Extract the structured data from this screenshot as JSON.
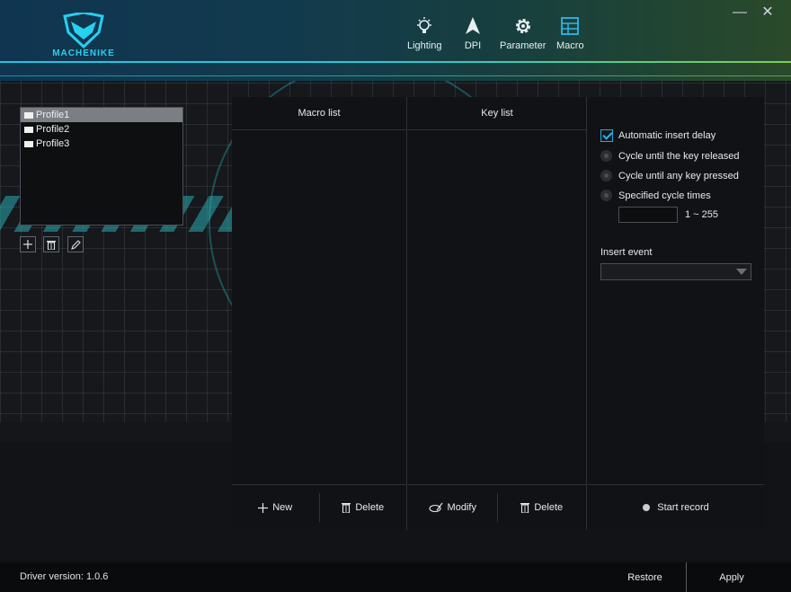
{
  "brand": {
    "logo_text": "MACHENIKE"
  },
  "nav": [
    {
      "label": "Lighting",
      "icon": "bulb-icon"
    },
    {
      "label": "DPI",
      "icon": "arrow-cursor-icon"
    },
    {
      "label": "Parameter",
      "icon": "gear-icon"
    },
    {
      "label": "Macro",
      "icon": "grid-icon",
      "active": true
    }
  ],
  "window": {
    "minimize": "—",
    "close": "✕"
  },
  "profiles": {
    "items": [
      "Profile1",
      "Profile2",
      "Profile3"
    ],
    "selected": "Profile1",
    "tools": [
      "add-icon",
      "trash-icon",
      "pencil-icon"
    ]
  },
  "macro_list": {
    "header": "Macro list",
    "new_label": "New",
    "delete_label": "Delete"
  },
  "key_list": {
    "header": "Key list",
    "modify_label": "Modify",
    "delete_label": "Delete"
  },
  "options": {
    "auto_delay_label": "Automatic insert delay",
    "auto_delay_checked": true,
    "radio_options": [
      "Cycle until the key released",
      "Cycle until any key pressed",
      "Specified cycle times"
    ],
    "cycle_value": "",
    "cycle_range": "1 ~ 255",
    "insert_event_label": "Insert event",
    "insert_event_value": "",
    "start_record_label": "Start record"
  },
  "footer": {
    "version": "Driver version: 1.0.6",
    "restore_label": "Restore",
    "apply_label": "Apply"
  },
  "colors": {
    "accent": "#2fb6ea",
    "header_left": "#0f3550",
    "header_right": "#2a4a2a"
  }
}
